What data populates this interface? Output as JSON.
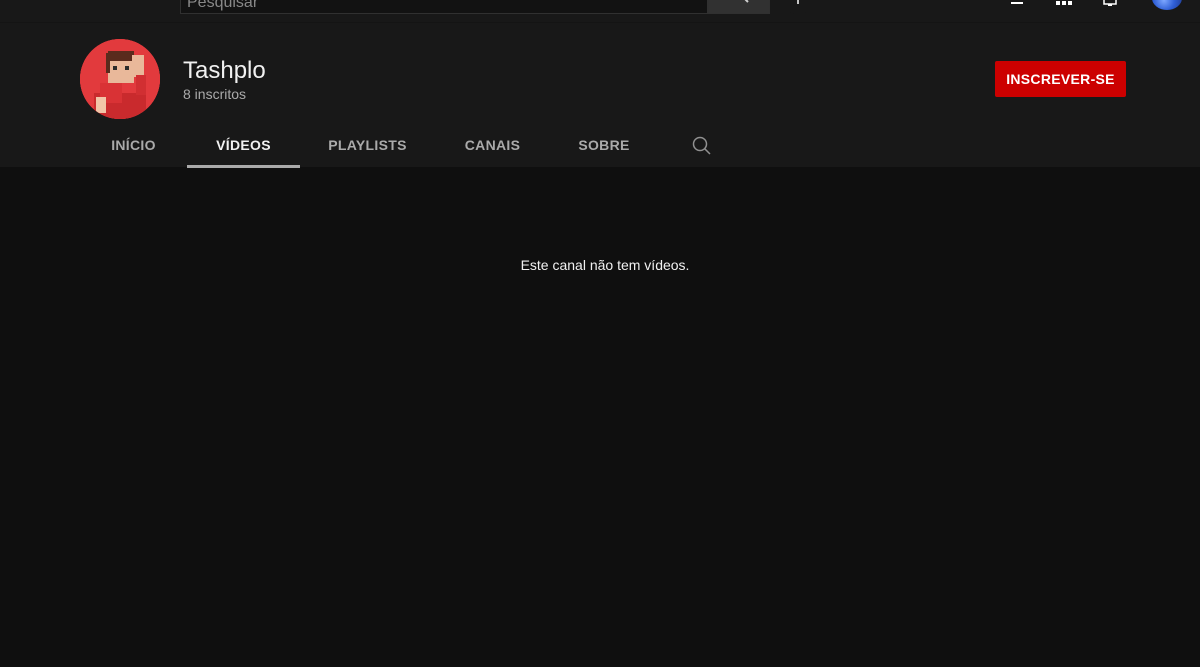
{
  "masthead": {
    "search_placeholder": "Pesquisar"
  },
  "channel": {
    "name": "Tashplo",
    "subscribers": "8 inscritos",
    "subscribe_label": "INSCREVER-SE"
  },
  "tabs": [
    {
      "label": "INÍCIO",
      "active": false
    },
    {
      "label": "VÍDEOS",
      "active": true
    },
    {
      "label": "PLAYLISTS",
      "active": false
    },
    {
      "label": "CANAIS",
      "active": false
    },
    {
      "label": "SOBRE",
      "active": false
    }
  ],
  "main": {
    "empty_message": "Este canal não tem vídeos."
  },
  "colors": {
    "background": "#0f0f0f",
    "header": "#181818",
    "subscribe": "#cc0000"
  },
  "icons": [
    "search-icon",
    "mic-icon",
    "create-video-icon",
    "apps-icon",
    "notifications-icon",
    "avatar"
  ]
}
